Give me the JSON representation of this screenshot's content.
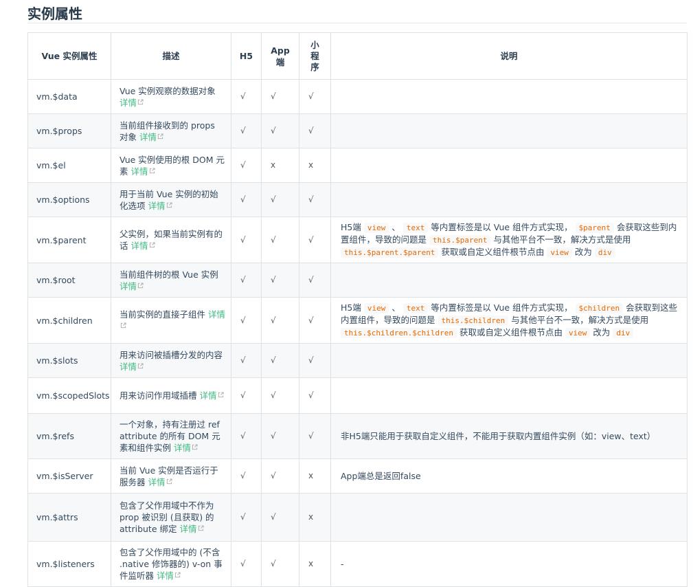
{
  "page": {
    "title": "实例属性"
  },
  "table": {
    "headers": [
      "Vue 实例属性",
      "描述",
      "H5",
      "App端",
      "小程序",
      "说明"
    ],
    "header_parts": {
      "app": [
        "App",
        "端"
      ],
      "mp": [
        "小",
        "程",
        "序"
      ]
    },
    "link_text": "详情",
    "rows": [
      {
        "name": "vm.$data",
        "desc": "Vue 实例观察的数据对象",
        "h5": "√",
        "app": "√",
        "mp": "√",
        "note": ""
      },
      {
        "name": "vm.$props",
        "desc": "当前组件接收到的 props 对象",
        "h5": "√",
        "app": "√",
        "mp": "√",
        "note": ""
      },
      {
        "name": "vm.$el",
        "desc": "Vue 实例使用的根 DOM 元素",
        "h5": "√",
        "app": "x",
        "mp": "x",
        "note": ""
      },
      {
        "name": "vm.$options",
        "desc": "用于当前 Vue 实例的初始化选项",
        "h5": "√",
        "app": "√",
        "mp": "√",
        "note": ""
      },
      {
        "name": "vm.$parent",
        "desc": "父实例，如果当前实例有的话",
        "h5": "√",
        "app": "√",
        "mp": "√",
        "note_parts": {
          "t1": "H5端",
          "c1": "view",
          "t2": "、",
          "c2": "text",
          "t3": "等内置标签是以 Vue 组件方式实现，",
          "c3": "$parent",
          "t4": "会获取这些到内置组件，导致的问题是",
          "c4": "this.$parent",
          "t5": "与其他平台不一致，解决方式是使用",
          "c5": "this.$parent.$parent",
          "t6": "获取或自定义组件根节点由",
          "c6": "view",
          "t7": "改为",
          "c7": "div"
        }
      },
      {
        "name": "vm.$root",
        "desc": "当前组件树的根 Vue 实例",
        "h5": "√",
        "app": "√",
        "mp": "√",
        "note": ""
      },
      {
        "name": "vm.$children",
        "desc": "当前实例的直接子组件",
        "h5": "√",
        "app": "√",
        "mp": "√",
        "note_parts": {
          "t1": "H5端",
          "c1": "view",
          "t2": "、",
          "c2": "text",
          "t3": "等内置标签是以 Vue 组件方式实现，",
          "c3": "$children",
          "t4": "会获取到这些内置组件，导致的问题是",
          "c4": "this.$children",
          "t5": "与其他平台不一致，解决方式是使用",
          "c5": "this.$children.$children",
          "t6": "获取或自定义组件根节点由",
          "c6": "view",
          "t7": "改为",
          "c7": "div"
        }
      },
      {
        "name": "vm.$slots",
        "desc": "用来访问被插槽分发的内容",
        "h5": "√",
        "app": "√",
        "mp": "√",
        "note": ""
      },
      {
        "name": "vm.$scopedSlots",
        "desc": "用来访问作用域插槽",
        "h5": "√",
        "app": "√",
        "mp": "√",
        "note": ""
      },
      {
        "name": "vm.$refs",
        "desc": "一个对象，持有注册过 ref attribute 的所有 DOM 元素和组件实例",
        "h5": "√",
        "app": "√",
        "mp": "√",
        "note": "非H5端只能用于获取自定义组件，不能用于获取内置组件实例（如：view、text）"
      },
      {
        "name": "vm.$isServer",
        "desc": "当前 Vue 实例是否运行于服务器",
        "h5": "√",
        "app": "√",
        "mp": "x",
        "note": "App端总是返回false"
      },
      {
        "name": "vm.$attrs",
        "desc": "包含了父作用域中不作为 prop 被识别 (且获取) 的 attribute 绑定",
        "h5": "√",
        "app": "√",
        "mp": "x",
        "note": ""
      },
      {
        "name": "vm.$listeners",
        "desc": "包含了父作用域中的 (不含 .native 修饰器的) v-on 事件监听器",
        "h5": "√",
        "app": "√",
        "mp": "x",
        "note": "-"
      }
    ]
  },
  "colors": {
    "link": "#42b983",
    "code": "#e96900",
    "border": "#dfe2e5",
    "stripe": "#f6f8fa"
  },
  "icons": {
    "link_icon": "external-link-icon"
  }
}
